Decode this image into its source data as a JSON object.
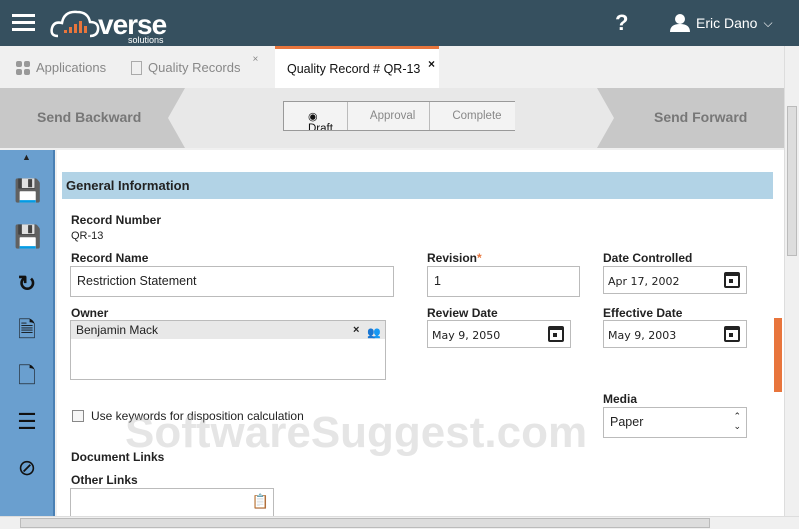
{
  "header": {
    "logo": "verse",
    "logo_sub": "solutions",
    "help": "?",
    "user": "Eric Dano"
  },
  "tabs": [
    {
      "label": "Applications"
    },
    {
      "label": "Quality Records"
    },
    {
      "label": "Quality Record # QR-13"
    }
  ],
  "workflow": {
    "back": "Send Backward",
    "forward": "Send Forward",
    "steps": [
      "Draft",
      "Approval",
      "Complete"
    ]
  },
  "section": "General Information",
  "form": {
    "record_number_label": "Record Number",
    "record_number": "QR-13",
    "record_name_label": "Record Name",
    "record_name": "Restriction Statement",
    "revision_label": "Revision",
    "revision": "1",
    "date_controlled_label": "Date Controlled",
    "date_controlled": "Apr 17, 2002",
    "owner_label": "Owner",
    "owner": "Benjamin Mack",
    "review_date_label": "Review Date",
    "review_date": "May 9, 2050",
    "effective_date_label": "Effective Date",
    "effective_date": "May 9, 2003",
    "keywords_label": "Use keywords for disposition calculation",
    "media_label": "Media",
    "media": "Paper",
    "doc_links_label": "Document Links",
    "other_links_label": "Other Links"
  },
  "watermark": "SoftwareSuggest.com",
  "colors": {
    "header": "#36505f",
    "accent": "#e8753c",
    "sidebar": "#6a9fcf",
    "section": "#b2d3e6"
  }
}
